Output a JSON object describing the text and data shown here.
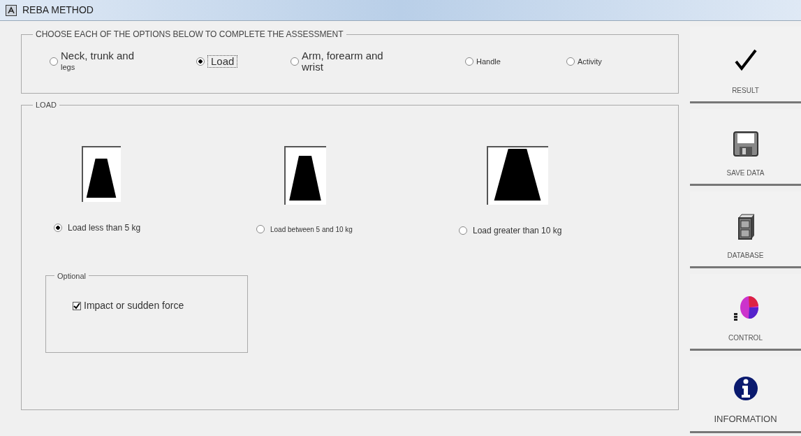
{
  "window": {
    "title": "REBA METHOD"
  },
  "assessment": {
    "legend": "CHOOSE EACH OF THE OPTIONS BELOW TO COMPLETE THE ASSESSMENT",
    "options": [
      {
        "lines": [
          "Neck, trunk and",
          "legs"
        ],
        "selected": false
      },
      {
        "lines": [
          "Load"
        ],
        "selected": true
      },
      {
        "lines": [
          "Arm, forearm and",
          "wrist"
        ],
        "selected": false
      },
      {
        "lines": [
          "Handle"
        ],
        "selected": false
      },
      {
        "lines": [
          "Activity"
        ],
        "selected": false
      }
    ]
  },
  "load": {
    "legend": "LOAD",
    "options": [
      {
        "label": "Load less than 5 kg",
        "selected": true
      },
      {
        "label": "Load between 5 and 10 kg",
        "selected": false
      },
      {
        "label": "Load greater than 10 kg",
        "selected": false
      }
    ],
    "optional": {
      "legend": "Optional",
      "checkbox": {
        "label": "Impact or sudden force",
        "checked": true
      }
    }
  },
  "sidebar": [
    {
      "label": "RESULT",
      "kind": "check"
    },
    {
      "label": "SAVE DATA",
      "kind": "floppy"
    },
    {
      "label": "DATABASE",
      "kind": "cabinet"
    },
    {
      "label": "CONTROL",
      "kind": "chart"
    },
    {
      "label": "INFORMATION",
      "kind": "info"
    }
  ]
}
